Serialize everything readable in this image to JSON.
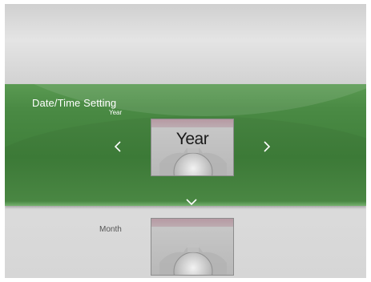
{
  "setting": {
    "title": "Date/Time Setting",
    "subtitle": "Year"
  },
  "current_item": {
    "label": "Year"
  },
  "next_item": {
    "label": "Month"
  },
  "icons": {
    "left": "chevron-left-icon",
    "right": "chevron-right-icon",
    "down": "chevron-down-icon"
  },
  "colors": {
    "band_green": "#4a8a44",
    "text_white": "#ffffff"
  }
}
